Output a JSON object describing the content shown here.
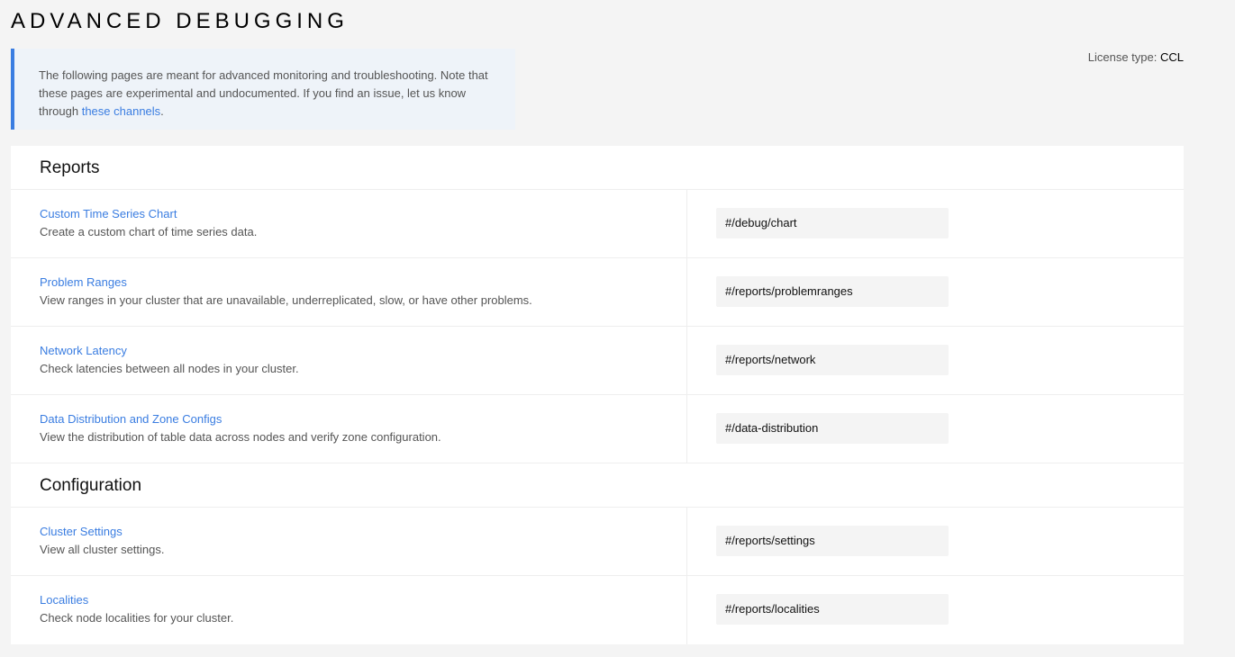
{
  "page": {
    "title": "ADVANCED DEBUGGING",
    "license_label": "License type:",
    "license_value": "CCL"
  },
  "notice": {
    "text": "The following pages are meant for advanced monitoring and troubleshooting. Note that these pages are experimental and undocumented. If you find an issue, let us know through",
    "link": "these channels",
    "end": "."
  },
  "sections": [
    {
      "title": "Reports",
      "items": [
        {
          "label": "Custom Time Series Chart",
          "desc": "Create a custom chart of time series data.",
          "url": "#/debug/chart"
        },
        {
          "label": "Problem Ranges",
          "desc": "View ranges in your cluster that are unavailable, underreplicated, slow, or have other problems.",
          "url": "#/reports/problemranges"
        },
        {
          "label": "Network Latency",
          "desc": "Check latencies between all nodes in your cluster.",
          "url": "#/reports/network"
        },
        {
          "label": "Data Distribution and Zone Configs",
          "desc": "View the distribution of table data across nodes and verify zone configuration.",
          "url": "#/data-distribution"
        }
      ]
    },
    {
      "title": "Configuration",
      "items": [
        {
          "label": "Cluster Settings",
          "desc": "View all cluster settings.",
          "url": "#/reports/settings"
        },
        {
          "label": "Localities",
          "desc": "Check node localities for your cluster.",
          "url": "#/reports/localities"
        }
      ]
    }
  ]
}
